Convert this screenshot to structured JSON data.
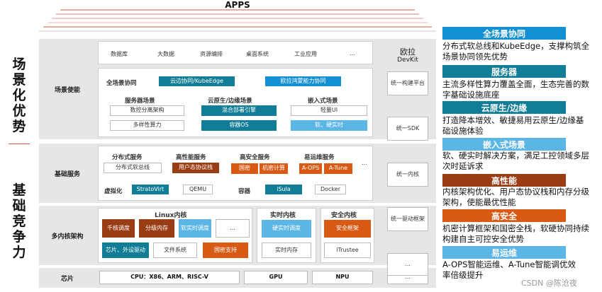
{
  "header": {
    "title": "APPS"
  },
  "side_titles": {
    "top": "场景化优势",
    "bottom": "基础竞争力"
  },
  "layers": {
    "scene": {
      "label": "场景使能",
      "apps": [
        "数据库",
        "大数据",
        "资源编排",
        "桌面系统",
        "工业应用",
        "..."
      ],
      "full_scene": {
        "label": "全场景协同",
        "items": [
          "云边协同/KubeEdge",
          "欧拉鸿蒙能力协同"
        ]
      },
      "server": {
        "label": "服务器场景",
        "items": [
          "数控分离架构",
          "多样性算力"
        ]
      },
      "cloud": {
        "label": "云原生/边缘场景",
        "items": [
          "混合部署引擎",
          "容器OS"
        ]
      },
      "embedded": {
        "label": "嵌入式场景",
        "items": [
          "轻量UI",
          "软、硬实时"
        ]
      }
    },
    "base": {
      "label": "基础服务",
      "groups": [
        {
          "label": "分布式服务",
          "items": [
            "分布式软总线"
          ]
        },
        {
          "label": "高性能服务",
          "items": [
            "用户态协议栈"
          ]
        },
        {
          "label": "高安全服务",
          "items": [
            "国密",
            "机密计算"
          ]
        },
        {
          "label": "易运维服务",
          "items": [
            "A-OPS",
            "A-Tune"
          ]
        }
      ],
      "more": "...",
      "virt": {
        "label": "虚拟化",
        "items": [
          "StratoVirt",
          "QEMU"
        ]
      },
      "container": {
        "label": "容器",
        "items": [
          "iSula",
          "Docker"
        ]
      }
    },
    "kernel": {
      "label": "多内核架构",
      "linux": {
        "label": "Linux内核",
        "items": [
          "千核调度",
          "分级内存",
          "软实时调度",
          "...",
          "芯片、外设驱动",
          "文件系统",
          "国密支持"
        ]
      },
      "realtime": {
        "label": "实时内核",
        "items": [
          "硬实时调度",
          "实时内存"
        ]
      },
      "security": {
        "label": "安全内核",
        "items": [
          "安全框架",
          "iTrustee"
        ]
      }
    },
    "chip": {
      "label": "芯片",
      "items": [
        "CPU：X86、ARM、RISC-V",
        "GPU",
        "NPU",
        "..."
      ]
    }
  },
  "devkit": {
    "title": "欧拉",
    "subtitle": "DevKit",
    "items": [
      "统一构建平台",
      "统一SDK",
      "统一内核",
      "统一驱动框架",
      "..."
    ]
  },
  "advantages": [
    {
      "title": "全场景协同",
      "desc": "分布式软总线和KubeEdge，支撑构筑全场景协同领先优势",
      "color": "#1390d4"
    },
    {
      "title": "服务器",
      "desc": "主流多样性算力覆盖全面，生态完善的数字基础设施底座",
      "color": "#117d96"
    },
    {
      "title": "云原生/边缘",
      "desc": "打造降本增效、敏捷易用云原生/边缘基础设施体验",
      "color": "#117d96"
    },
    {
      "title": "嵌入式场景",
      "desc": "软、硬实时解决方案，满足工控领域多层次时延诉求",
      "color": "#5bb6e6"
    },
    {
      "title": "高性能",
      "desc": "内核架构优化、用户态协议栈和内存分级架构，使能最优性能",
      "color": "#9a3d14"
    },
    {
      "title": "高安全",
      "desc": "机密计算框架和国密全栈，软硬协同持续构建自主可控安全优势",
      "color": "#d95a15"
    },
    {
      "title": "易运维",
      "desc": "A-OPS智能运维、A-Tune智能调优效率倍级提升",
      "color": "#5bb6e6"
    }
  ],
  "watermark": "CSDN @陈沧夜"
}
